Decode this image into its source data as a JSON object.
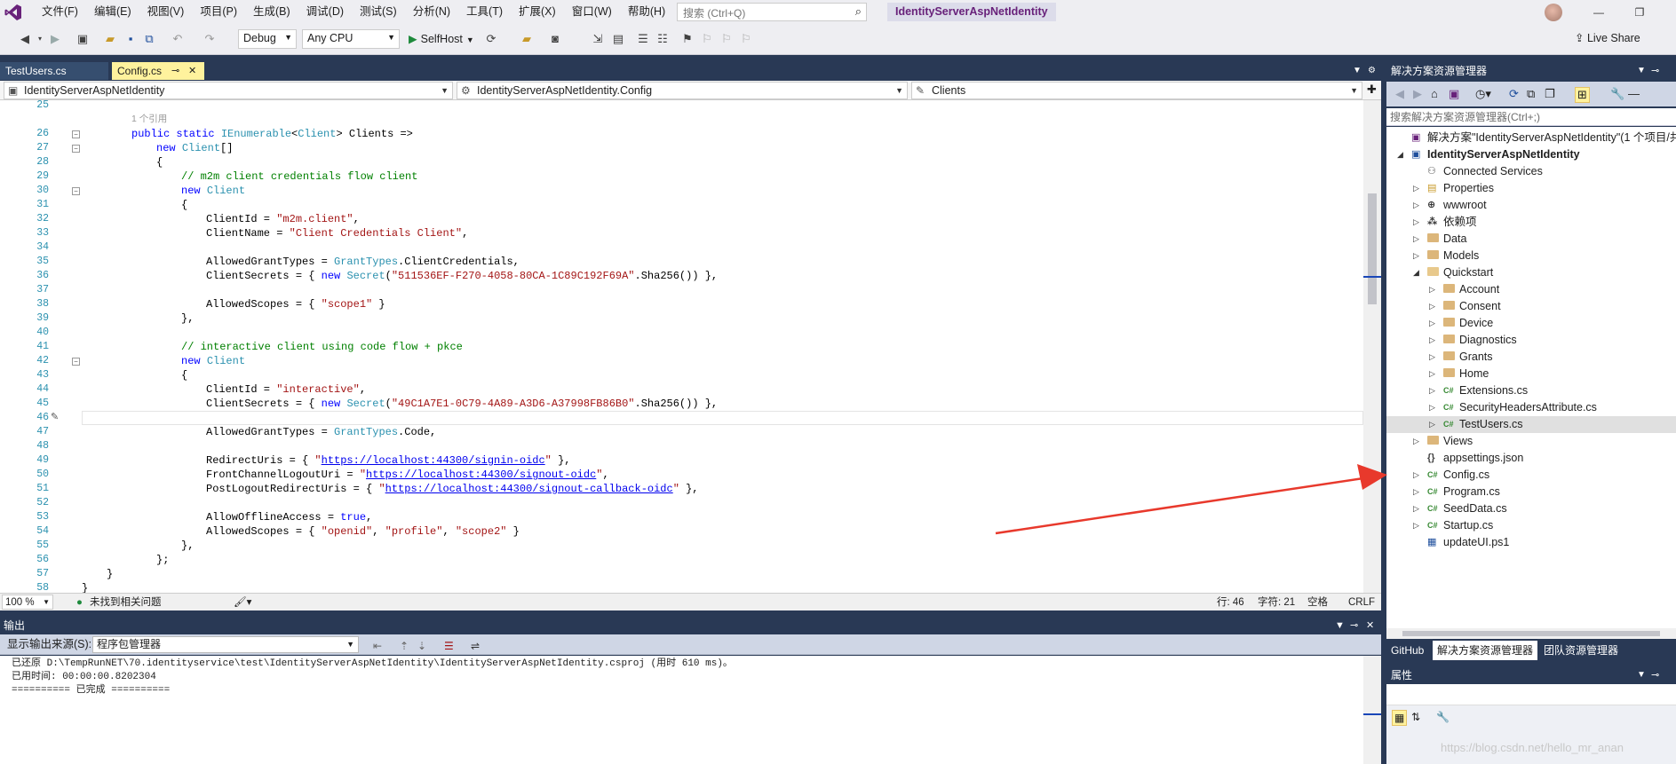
{
  "window": {
    "menu": [
      "文件(F)",
      "编辑(E)",
      "视图(V)",
      "项目(P)",
      "生成(B)",
      "调试(D)",
      "测试(S)",
      "分析(N)",
      "工具(T)",
      "扩展(X)",
      "窗口(W)",
      "帮助(H)"
    ],
    "search_placeholder": "搜索 (Ctrl+Q)",
    "solution_title": "IdentityServerAspNetIdentity",
    "minimize": "—",
    "restore": "❐",
    "live_share": "Live Share"
  },
  "toolbar": {
    "config": "Debug",
    "platform": "Any CPU",
    "run_target": "SelfHost"
  },
  "tabs": [
    {
      "label": "TestUsers.cs"
    },
    {
      "label": "Config.cs"
    }
  ],
  "navbar": {
    "project": "IdentityServerAspNetIdentity",
    "type": "IdentityServerAspNetIdentity.Config",
    "member": "Clients"
  },
  "editor": {
    "line_numbers": [
      "25",
      "26",
      "27",
      "28",
      "29",
      "30",
      "31",
      "32",
      "33",
      "34",
      "35",
      "36",
      "37",
      "38",
      "39",
      "40",
      "41",
      "42",
      "43",
      "44",
      "45",
      "46",
      "47",
      "48",
      "49",
      "50",
      "51",
      "52",
      "53",
      "54",
      "55",
      "56",
      "57",
      "58"
    ],
    "codelens": "1 个引用",
    "code": {
      "l26_a": "public static ",
      "l26_b": "IEnumerable",
      "l26_c": "<",
      "l26_d": "Client",
      "l26_e": "> Clients =>",
      "l27_a": "new ",
      "l27_b": "Client",
      "l27_c": "[]",
      "l28": "{",
      "l29": "// m2m client credentials flow client",
      "l30_a": "new ",
      "l30_b": "Client",
      "l31": "{",
      "l32_a": "ClientId = ",
      "l32_b": "\"m2m.client\"",
      "l32_c": ",",
      "l33_a": "ClientName = ",
      "l33_b": "\"Client Credentials Client\"",
      "l33_c": ",",
      "l35_a": "AllowedGrantTypes = ",
      "l35_b": "GrantTypes",
      "l35_c": ".ClientCredentials,",
      "l36_a": "ClientSecrets = { ",
      "l36_b": "new ",
      "l36_c": "Secret",
      "l36_d": "(",
      "l36_e": "\"511536EF-F270-4058-80CA-1C89C192F69A\"",
      "l36_f": ".Sha256()) },",
      "l38_a": "AllowedScopes = { ",
      "l38_b": "\"scope1\"",
      "l38_c": " }",
      "l39": "},",
      "l41": "// interactive client using code flow + pkce",
      "l42_a": "new ",
      "l42_b": "Client",
      "l43": "{",
      "l44_a": "ClientId = ",
      "l44_b": "\"interactive\"",
      "l44_c": ",",
      "l45_a": "ClientSecrets = { ",
      "l45_b": "new ",
      "l45_c": "Secret",
      "l45_d": "(",
      "l45_e": "\"49C1A7E1-0C79-4A89-A3D6-A37998FB86B0\"",
      "l45_f": ".Sha256()) },",
      "l47_a": "AllowedGrantTypes = ",
      "l47_b": "GrantTypes",
      "l47_c": ".Code,",
      "l49_a": "RedirectUris = { ",
      "l49_q1": "\"",
      "l49_b": "https://localhost:44300/signin-oidc",
      "l49_q2": "\"",
      "l49_c": " },",
      "l50_a": "FrontChannelLogoutUri = ",
      "l50_q1": "\"",
      "l50_b": "https://localhost:44300/signout-oidc",
      "l50_q2": "\"",
      "l50_c": ",",
      "l51_a": "PostLogoutRedirectUris = { ",
      "l51_q1": "\"",
      "l51_b": "https://localhost:44300/signout-callback-oidc",
      "l51_q2": "\"",
      "l51_c": " },",
      "l53_a": "AllowOfflineAccess = ",
      "l53_b": "true",
      "l53_c": ",",
      "l54_a": "AllowedScopes = { ",
      "l54_b": "\"openid\"",
      "l54_c": ", ",
      "l54_d": "\"profile\"",
      "l54_e": ", ",
      "l54_f": "\"scope2\"",
      "l54_g": " }",
      "l55": "},",
      "l56": "};",
      "l57": "}",
      "l58": "}"
    }
  },
  "editor_status": {
    "zoom": "100 %",
    "issues": "未找到相关问题",
    "line": "行: 46",
    "col": "字符: 21",
    "spacing": "空格",
    "eol": "CRLF"
  },
  "output": {
    "title": "输出",
    "source_label": "显示输出来源(S):",
    "source": "程序包管理器",
    "lines": [
      "已还原 D:\\TempRunNET\\70.identityservice\\test\\IdentityServerAspNetIdentity\\IdentityServerAspNetIdentity.csproj (用时 610 ms)。",
      "已用时间: 00:00:00.8202304",
      "========== 已完成 =========="
    ]
  },
  "solution_explorer": {
    "title": "解决方案资源管理器",
    "search_placeholder": "搜索解决方案资源管理器(Ctrl+;)",
    "items": [
      {
        "label": "解决方案\"IdentityServerAspNetIdentity\"(1 个项目/共",
        "level": 0,
        "icon": "solution-icon",
        "expander": ""
      },
      {
        "label": "IdentityServerAspNetIdentity",
        "level": 1,
        "icon": "project-icon",
        "expander": "◢",
        "bold": true
      },
      {
        "label": "Connected Services",
        "level": 2,
        "icon": "connected-services-icon",
        "expander": ""
      },
      {
        "label": "Properties",
        "level": 2,
        "icon": "properties-icon",
        "expander": "▷"
      },
      {
        "label": "wwwroot",
        "level": 2,
        "icon": "globe-icon",
        "expander": "▷"
      },
      {
        "label": "依赖项",
        "level": 2,
        "icon": "dependencies-icon",
        "expander": "▷"
      },
      {
        "label": "Data",
        "level": 2,
        "icon": "folder-icon",
        "expander": "▷"
      },
      {
        "label": "Models",
        "level": 2,
        "icon": "folder-icon",
        "expander": "▷"
      },
      {
        "label": "Quickstart",
        "level": 2,
        "icon": "folder-open-icon",
        "expander": "◢"
      },
      {
        "label": "Account",
        "level": 3,
        "icon": "folder-icon",
        "expander": "▷"
      },
      {
        "label": "Consent",
        "level": 3,
        "icon": "folder-icon",
        "expander": "▷"
      },
      {
        "label": "Device",
        "level": 3,
        "icon": "folder-icon",
        "expander": "▷"
      },
      {
        "label": "Diagnostics",
        "level": 3,
        "icon": "folder-icon",
        "expander": "▷"
      },
      {
        "label": "Grants",
        "level": 3,
        "icon": "folder-icon",
        "expander": "▷"
      },
      {
        "label": "Home",
        "level": 3,
        "icon": "folder-icon",
        "expander": "▷"
      },
      {
        "label": "Extensions.cs",
        "level": 3,
        "icon": "csharp-file-icon",
        "expander": "▷"
      },
      {
        "label": "SecurityHeadersAttribute.cs",
        "level": 3,
        "icon": "csharp-file-icon",
        "expander": "▷"
      },
      {
        "label": "TestUsers.cs",
        "level": 3,
        "icon": "csharp-file-icon",
        "expander": "▷",
        "selected": true
      },
      {
        "label": "Views",
        "level": 2,
        "icon": "folder-icon",
        "expander": "▷"
      },
      {
        "label": "appsettings.json",
        "level": 2,
        "icon": "json-file-icon",
        "expander": ""
      },
      {
        "label": "Config.cs",
        "level": 2,
        "icon": "csharp-file-icon",
        "expander": "▷"
      },
      {
        "label": "Program.cs",
        "level": 2,
        "icon": "csharp-file-icon",
        "expander": "▷"
      },
      {
        "label": "SeedData.cs",
        "level": 2,
        "icon": "csharp-file-icon",
        "expander": "▷"
      },
      {
        "label": "Startup.cs",
        "level": 2,
        "icon": "csharp-file-icon",
        "expander": "▷"
      },
      {
        "label": "updateUI.ps1",
        "level": 2,
        "icon": "powershell-file-icon",
        "expander": ""
      }
    ],
    "bottom_tabs": [
      "GitHub",
      "解决方案资源管理器",
      "团队资源管理器"
    ]
  },
  "properties": {
    "title": "属性"
  },
  "watermark": "https://blog.csdn.net/hello_mr_anan",
  "colors": {
    "accent": "#68217a",
    "chrome_dark": "#293955",
    "active_tab": "#fff29d",
    "annotation_arrow": "#e8392c"
  }
}
